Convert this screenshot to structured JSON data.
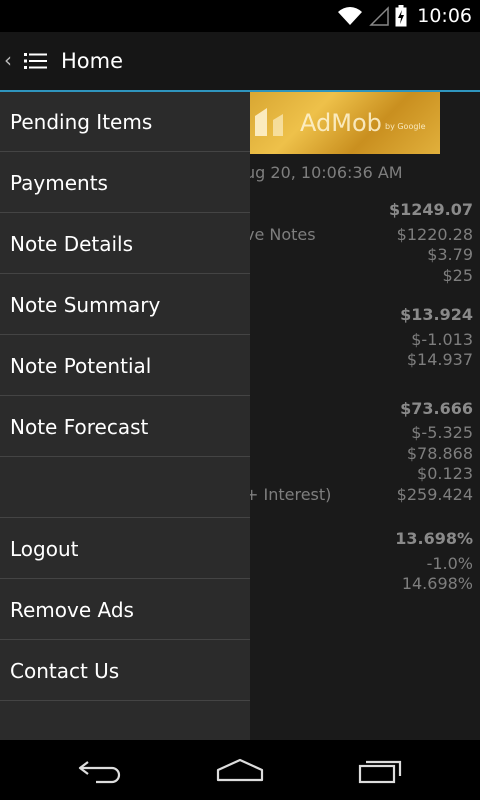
{
  "status": {
    "time": "10:06"
  },
  "header": {
    "title": "Home"
  },
  "ad": {
    "brand": "AdMob",
    "sub": "by Google"
  },
  "background": {
    "timestamp": "ug 20, 10:06:36 AM",
    "rows": [
      {
        "label": "",
        "value": "$1249.07",
        "bold": true
      },
      {
        "label": "ve Notes",
        "value": "$1220.28"
      },
      {
        "label": "",
        "value": "$3.79"
      },
      {
        "label": "",
        "value": "$25"
      },
      {
        "label": "",
        "value": "$13.924",
        "bold": true
      },
      {
        "label": "",
        "value": "$-1.013"
      },
      {
        "label": "",
        "value": "$14.937"
      },
      {
        "label": "",
        "value": "$73.666",
        "bold": true
      },
      {
        "label": "",
        "value": "$-5.325"
      },
      {
        "label": "",
        "value": "$78.868"
      },
      {
        "label": "",
        "value": "$0.123"
      },
      {
        "label": "+ Interest)",
        "value": "$259.424"
      },
      {
        "label": "",
        "value": "13.698%",
        "bold": true
      },
      {
        "label": "",
        "value": "-1.0%"
      },
      {
        "label": "",
        "value": "14.698%"
      }
    ]
  },
  "drawer": {
    "items": [
      "Pending Items",
      "Payments",
      "Note Details",
      "Note Summary",
      "Note Potential",
      "Note Forecast",
      "",
      "Logout",
      "Remove Ads",
      "Contact Us"
    ]
  }
}
